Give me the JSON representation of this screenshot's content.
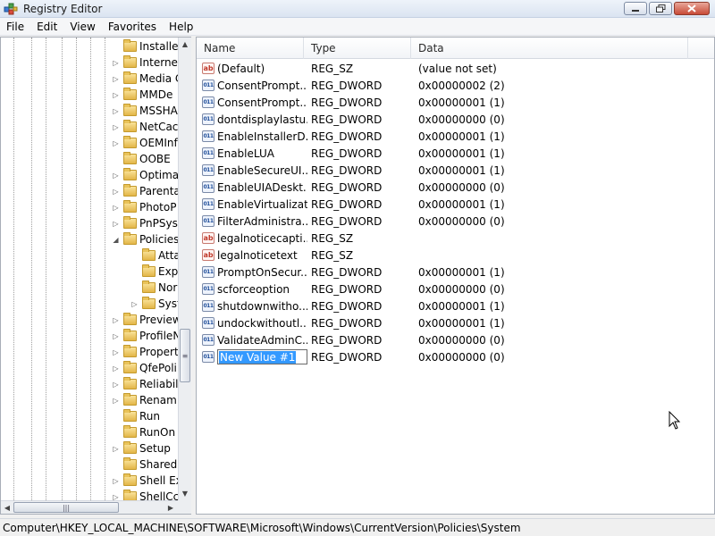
{
  "window": {
    "title": "Registry Editor"
  },
  "menu": [
    "File",
    "Edit",
    "View",
    "Favorites",
    "Help"
  ],
  "tree": {
    "items": [
      {
        "label": "Installe",
        "expander": ""
      },
      {
        "label": "Interne",
        "expander": "▷"
      },
      {
        "label": "Media C",
        "expander": "▷"
      },
      {
        "label": "MMDe",
        "expander": "▷"
      },
      {
        "label": "MSSHA",
        "expander": "▷"
      },
      {
        "label": "NetCac",
        "expander": "▷"
      },
      {
        "label": "OEMInf",
        "expander": "▷"
      },
      {
        "label": "OOBE",
        "expander": ""
      },
      {
        "label": "Optima",
        "expander": "▷"
      },
      {
        "label": "Parenta",
        "expander": "▷"
      },
      {
        "label": "PhotoP",
        "expander": "▷"
      },
      {
        "label": "PnPSys",
        "expander": "▷"
      },
      {
        "label": "Policies",
        "expander": "◢"
      },
      {
        "label": "Atta",
        "expander": "",
        "child": true
      },
      {
        "label": "Exp",
        "expander": "",
        "child": true
      },
      {
        "label": "Nor",
        "expander": "",
        "child": true
      },
      {
        "label": "Syst",
        "expander": "▷",
        "child": true
      },
      {
        "label": "Preview",
        "expander": "▷"
      },
      {
        "label": "ProfileN",
        "expander": "▷"
      },
      {
        "label": "Propert",
        "expander": "▷"
      },
      {
        "label": "QfePoli",
        "expander": "▷"
      },
      {
        "label": "Reliabil",
        "expander": "▷"
      },
      {
        "label": "Renam",
        "expander": "▷"
      },
      {
        "label": "Run",
        "expander": ""
      },
      {
        "label": "RunOn",
        "expander": ""
      },
      {
        "label": "Setup",
        "expander": "▷"
      },
      {
        "label": "SharedI",
        "expander": ""
      },
      {
        "label": "Shell Ex",
        "expander": "▷"
      },
      {
        "label": "ShellCc",
        "expander": "▷"
      }
    ]
  },
  "list": {
    "columns": {
      "name": "Name",
      "type": "Type",
      "data": "Data"
    },
    "rows": [
      {
        "name": "(Default)",
        "type": "REG_SZ",
        "data": "(value not set)",
        "icon": "sz"
      },
      {
        "name": "ConsentPrompt...",
        "type": "REG_DWORD",
        "data": "0x00000002 (2)",
        "icon": "dword"
      },
      {
        "name": "ConsentPrompt...",
        "type": "REG_DWORD",
        "data": "0x00000001 (1)",
        "icon": "dword"
      },
      {
        "name": "dontdisplaylastu...",
        "type": "REG_DWORD",
        "data": "0x00000000 (0)",
        "icon": "dword"
      },
      {
        "name": "EnableInstallerD...",
        "type": "REG_DWORD",
        "data": "0x00000001 (1)",
        "icon": "dword"
      },
      {
        "name": "EnableLUA",
        "type": "REG_DWORD",
        "data": "0x00000001 (1)",
        "icon": "dword"
      },
      {
        "name": "EnableSecureUI...",
        "type": "REG_DWORD",
        "data": "0x00000001 (1)",
        "icon": "dword"
      },
      {
        "name": "EnableUIADeskt...",
        "type": "REG_DWORD",
        "data": "0x00000000 (0)",
        "icon": "dword"
      },
      {
        "name": "EnableVirtualizat...",
        "type": "REG_DWORD",
        "data": "0x00000001 (1)",
        "icon": "dword"
      },
      {
        "name": "FilterAdministra...",
        "type": "REG_DWORD",
        "data": "0x00000000 (0)",
        "icon": "dword"
      },
      {
        "name": "legalnoticecapti...",
        "type": "REG_SZ",
        "data": "",
        "icon": "sz"
      },
      {
        "name": "legalnoticetext",
        "type": "REG_SZ",
        "data": "",
        "icon": "sz"
      },
      {
        "name": "PromptOnSecur...",
        "type": "REG_DWORD",
        "data": "0x00000001 (1)",
        "icon": "dword"
      },
      {
        "name": "scforceoption",
        "type": "REG_DWORD",
        "data": "0x00000000 (0)",
        "icon": "dword"
      },
      {
        "name": "shutdownwitho...",
        "type": "REG_DWORD",
        "data": "0x00000001 (1)",
        "icon": "dword"
      },
      {
        "name": "undockwithoutl...",
        "type": "REG_DWORD",
        "data": "0x00000001 (1)",
        "icon": "dword"
      },
      {
        "name": "ValidateAdminC...",
        "type": "REG_DWORD",
        "data": "0x00000000 (0)",
        "icon": "dword"
      },
      {
        "name": "New Value #1",
        "type": "REG_DWORD",
        "data": "0x00000000 (0)",
        "icon": "dword",
        "editing": true
      }
    ]
  },
  "status": {
    "path": "Computer\\HKEY_LOCAL_MACHINE\\SOFTWARE\\Microsoft\\Windows\\CurrentVersion\\Policies\\System"
  },
  "icons": {
    "app": "registry-editor-icon",
    "string_value": "string-value-icon",
    "dword_value": "dword-value-icon",
    "folder": "folder-icon"
  }
}
